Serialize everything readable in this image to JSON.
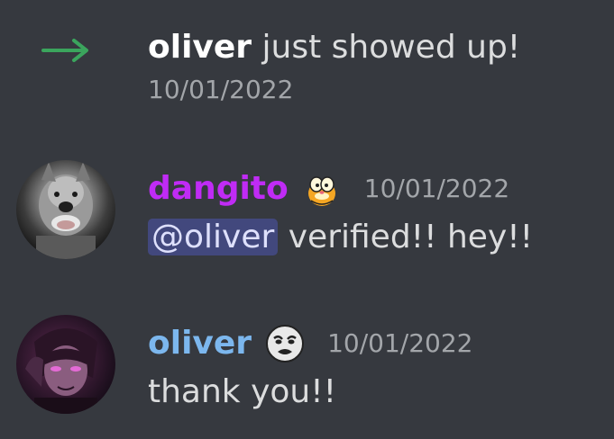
{
  "join": {
    "username": "oliver",
    "message": " just showed up!",
    "timestamp": "10/01/2022",
    "arrow_color": "#3ba55d"
  },
  "messages": [
    {
      "username": "dangito",
      "username_color": "#c02bf5",
      "emoji_icon": "garfield-emoji",
      "timestamp": "10/01/2022",
      "mention": "@oliver",
      "text": " verified!! hey!!"
    },
    {
      "username": "oliver",
      "username_color": "#7cb7ee",
      "emoji_icon": "troll-face-emoji",
      "timestamp": "10/01/2022",
      "text": "thank you!!"
    }
  ],
  "colors": {
    "background": "#36393f",
    "timestamp": "#a3a6aa",
    "text": "#dcddde",
    "mention_bg": "#5865f2"
  }
}
